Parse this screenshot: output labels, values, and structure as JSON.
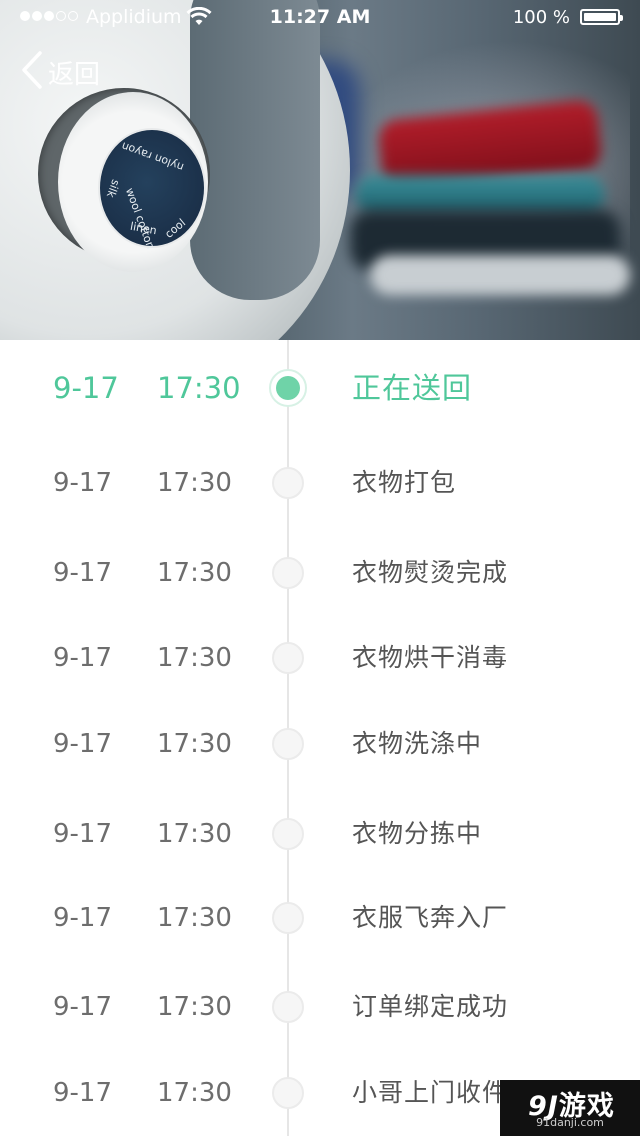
{
  "status_bar": {
    "carrier": "Applidium",
    "time": "11:27 AM",
    "battery": "100 %",
    "battery_level": 1.0,
    "signal_strength": 3,
    "signal_max": 5
  },
  "nav": {
    "back_label": "返回",
    "back_icon": "chevron-left-icon"
  },
  "hero": {
    "image": "iron-with-clothes-photo",
    "dial_labels": [
      "nylon rayon",
      "silk",
      "wool cotton",
      "linen",
      "cool"
    ]
  },
  "colors": {
    "accent": "#4fc79a",
    "text": "#6d6d6d",
    "line": "#e6e6e6"
  },
  "timeline": [
    {
      "date": "9-17",
      "time": "17:30",
      "status": "正在送回",
      "active": true
    },
    {
      "date": "9-17",
      "time": "17:30",
      "status": "衣物打包",
      "active": false
    },
    {
      "date": "9-17",
      "time": "17:30",
      "status": "衣物熨烫完成",
      "active": false
    },
    {
      "date": "9-17",
      "time": "17:30",
      "status": "衣物烘干消毒",
      "active": false
    },
    {
      "date": "9-17",
      "time": "17:30",
      "status": "衣物洗涤中",
      "active": false
    },
    {
      "date": "9-17",
      "time": "17:30",
      "status": "衣物分拣中",
      "active": false
    },
    {
      "date": "9-17",
      "time": "17:30",
      "status": "衣服飞奔入厂",
      "active": false
    },
    {
      "date": "9-17",
      "time": "17:30",
      "status": "订单绑定成功",
      "active": false
    },
    {
      "date": "9-17",
      "time": "17:30",
      "status": "小哥上门收件",
      "active": false
    }
  ],
  "watermark": {
    "logo_number": "9J",
    "logo_text": "游戏",
    "url": "91danji.com"
  }
}
